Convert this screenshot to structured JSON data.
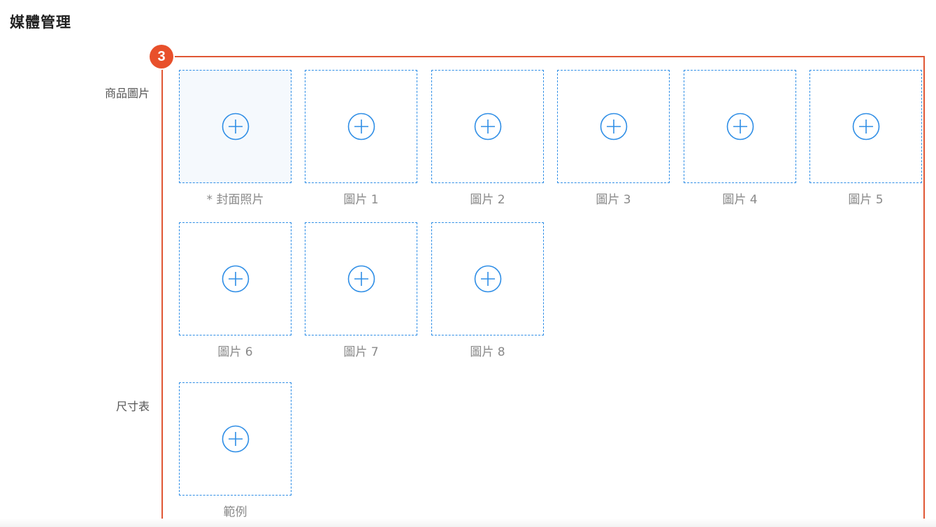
{
  "section": {
    "title": "媒體管理",
    "step_number": "3"
  },
  "rows": {
    "product_images_label": "商品圖片",
    "size_chart_label": "尺寸表"
  },
  "product_images": [
    {
      "label": "* 封面照片"
    },
    {
      "label": "圖片 1"
    },
    {
      "label": "圖片 2"
    },
    {
      "label": "圖片 3"
    },
    {
      "label": "圖片 4"
    },
    {
      "label": "圖片 5"
    },
    {
      "label": "圖片 6"
    },
    {
      "label": "圖片 7"
    },
    {
      "label": "圖片 8"
    }
  ],
  "size_chart": {
    "label": "範例"
  },
  "icons": {
    "add": "plus-circle-icon"
  },
  "colors": {
    "accent": "#2f8ee6",
    "highlight": "#e05634",
    "badge": "#e8502b"
  }
}
